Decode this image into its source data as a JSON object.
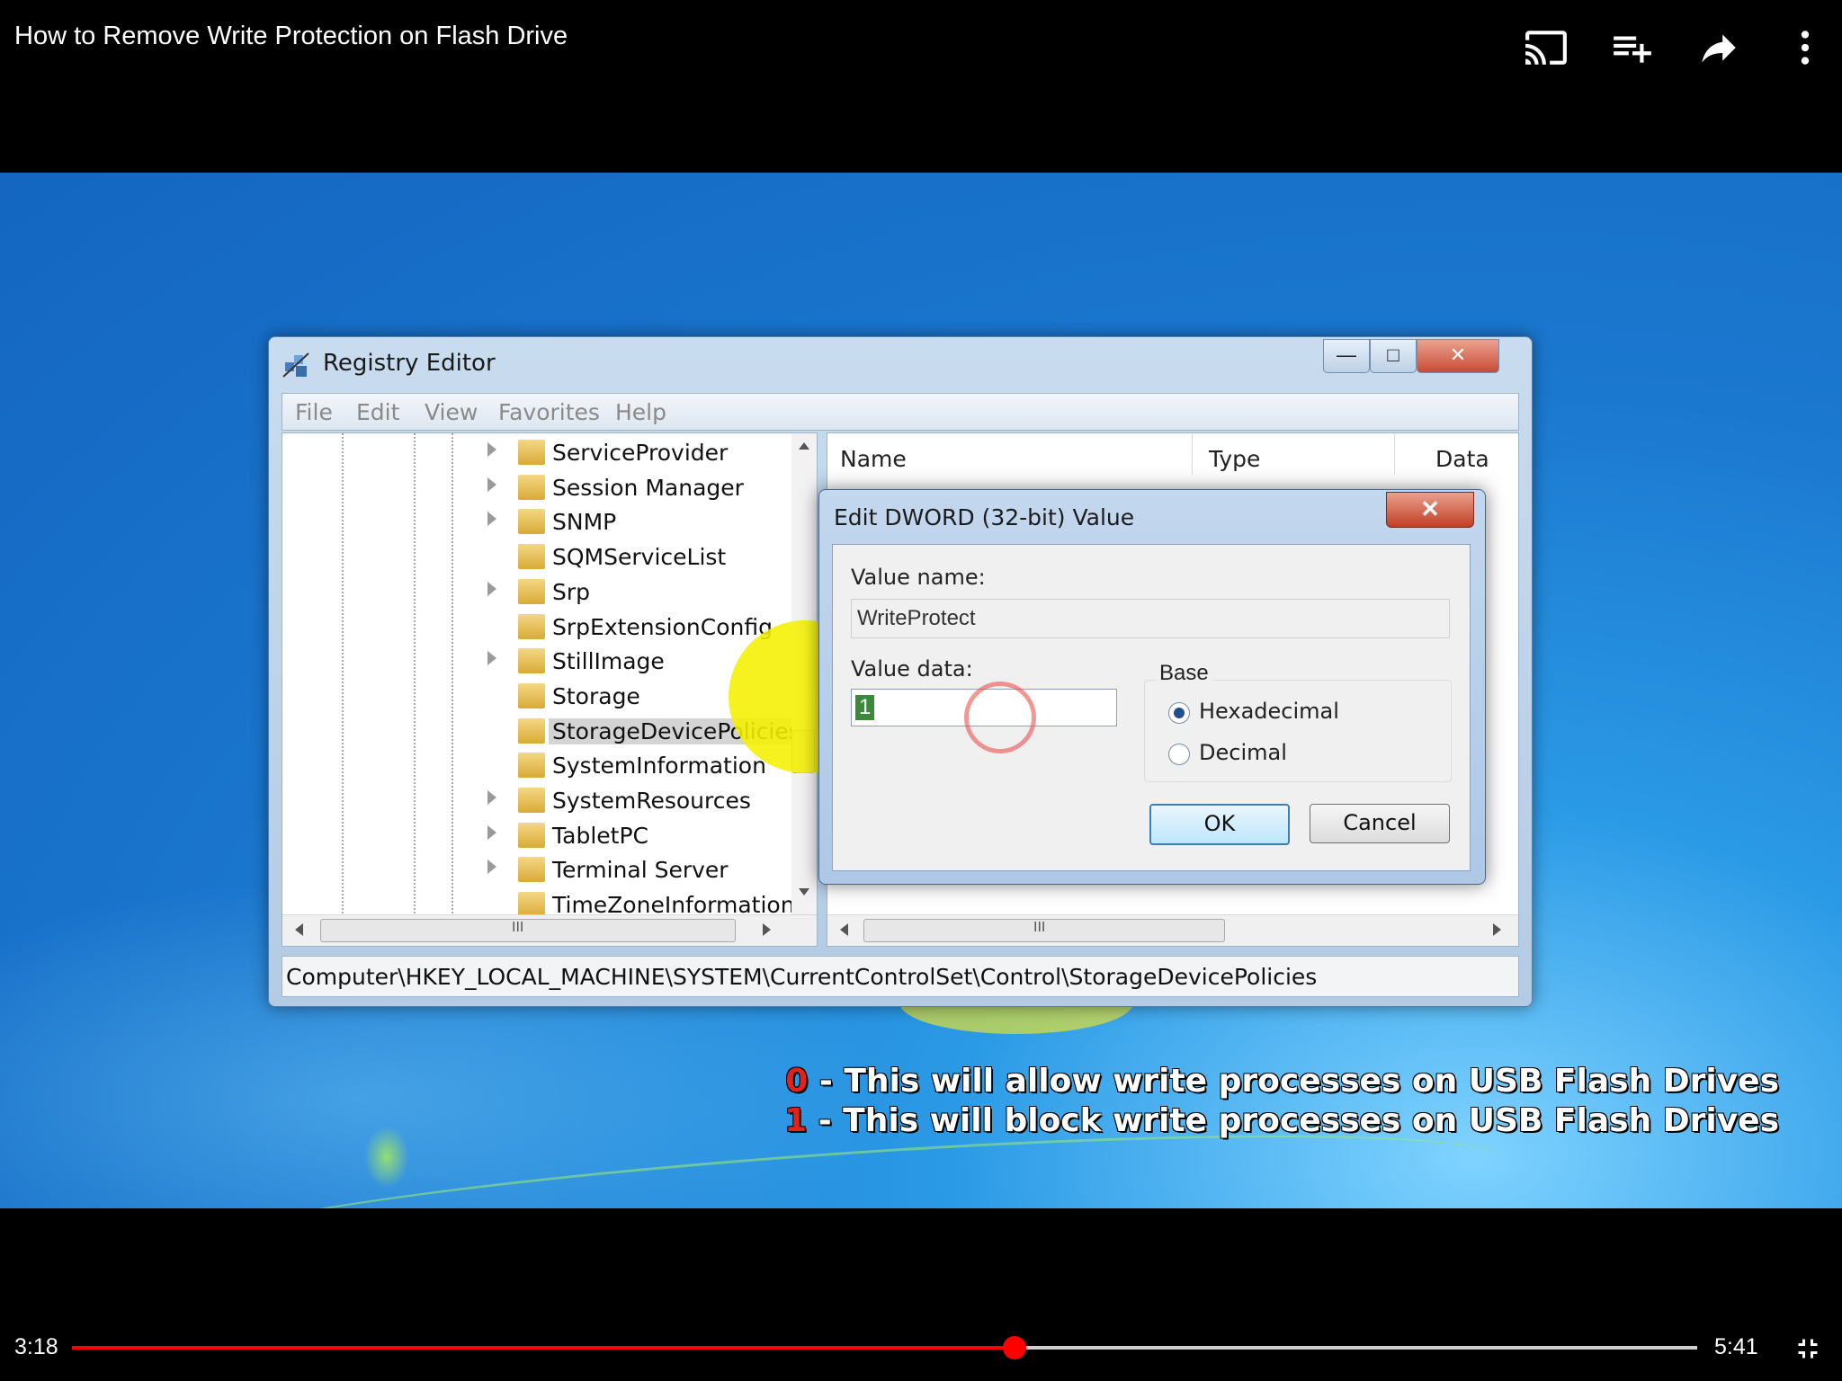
{
  "video": {
    "title": "How to Remove Write Protection on Flash Drive",
    "current_time": "3:18",
    "duration": "5:41",
    "progress_fraction": 0.58
  },
  "top_controls": [
    "cast-icon",
    "add-to-queue-icon",
    "share-icon",
    "more-options-icon"
  ],
  "registry_editor": {
    "title": "Registry Editor",
    "menu": [
      "File",
      "Edit",
      "View",
      "Favorites",
      "Help"
    ],
    "tree_items": [
      {
        "label": "ServiceProvider",
        "expandable": true
      },
      {
        "label": "Session Manager",
        "expandable": true
      },
      {
        "label": "SNMP",
        "expandable": true
      },
      {
        "label": "SQMServiceList",
        "expandable": false
      },
      {
        "label": "Srp",
        "expandable": true
      },
      {
        "label": "SrpExtensionConfig",
        "expandable": false
      },
      {
        "label": "StillImage",
        "expandable": true
      },
      {
        "label": "Storage",
        "expandable": false
      },
      {
        "label": "StorageDevicePolicies",
        "expandable": false,
        "selected": true
      },
      {
        "label": "SystemInformation",
        "expandable": false
      },
      {
        "label": "SystemResources",
        "expandable": true
      },
      {
        "label": "TabletPC",
        "expandable": true
      },
      {
        "label": "Terminal Server",
        "expandable": true
      },
      {
        "label": "TimeZoneInformation",
        "expandable": false
      }
    ],
    "columns": [
      "Name",
      "Type",
      "Data"
    ],
    "scrollbar_grip": "III",
    "status_path": "Computer\\HKEY_LOCAL_MACHINE\\SYSTEM\\CurrentControlSet\\Control\\StorageDevicePolicies"
  },
  "dialog": {
    "title": "Edit DWORD (32-bit) Value",
    "close": "✕",
    "value_name_label": "Value name:",
    "value_name": "WriteProtect",
    "value_data_label": "Value data:",
    "value_data": "1",
    "base_label": "Base",
    "base_options": [
      "Hexadecimal",
      "Decimal"
    ],
    "base_selected": "Hexadecimal",
    "ok": "OK",
    "cancel": "Cancel"
  },
  "captions": [
    {
      "num": "0",
      "text": " - This will allow write processes on USB Flash Drives"
    },
    {
      "num": "1",
      "text": " - This will block write processes on USB Flash Drives"
    }
  ],
  "colors": {
    "progress": "#ff0000",
    "caption_number": "#e0231b",
    "highlight": "#f5f000"
  }
}
